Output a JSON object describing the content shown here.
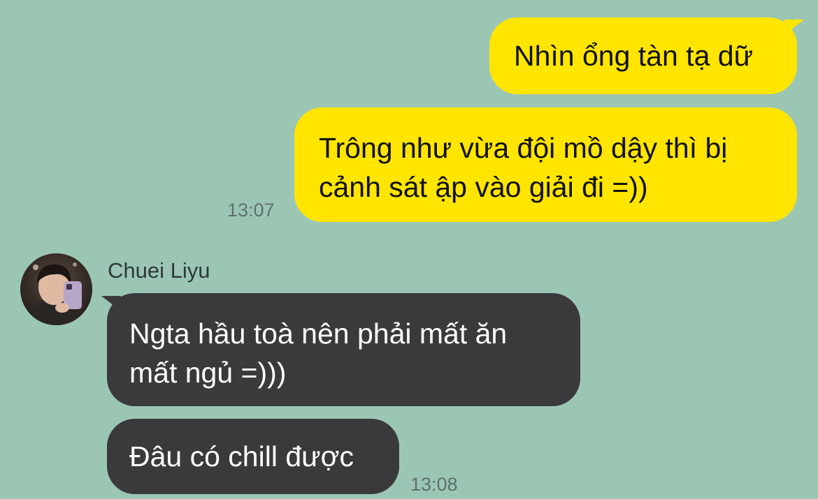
{
  "chat": {
    "messages": [
      {
        "direction": "outgoing",
        "text": "Nhìn ổng tàn tạ dữ"
      },
      {
        "direction": "outgoing",
        "text_lines": [
          "Trông như vừa đội mồ dậy thì bị",
          "cảnh sát ập vào giải đi =))"
        ],
        "time": "13:07"
      },
      {
        "direction": "incoming",
        "sender": "Chuei Liyu",
        "text_lines": [
          "Ngta hầu toà nên phải mất ăn",
          "mất ngủ =)))"
        ]
      },
      {
        "direction": "incoming",
        "text": "Đâu có chill được",
        "time": "13:08"
      }
    ],
    "contact": {
      "avatar_icon": "user-avatar-photo"
    }
  },
  "colors": {
    "background": "#9cc6b4",
    "outgoing_bubble": "#ffe500",
    "incoming_bubble": "#3a3a3c"
  }
}
